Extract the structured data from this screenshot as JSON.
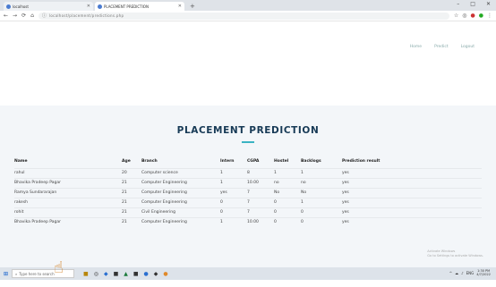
{
  "browser": {
    "tabs": [
      {
        "label": "localhost",
        "active": false
      },
      {
        "label": "PLACEMENT PREDICTION",
        "active": true
      }
    ],
    "new_tab": "+",
    "window_controls": [
      "–",
      "□",
      "✕"
    ],
    "url": "localhost/placement/predictions.php",
    "nav_buttons": [
      "←",
      "→",
      "⟳",
      "⌂"
    ],
    "extension_icons": [
      "☆",
      "◎",
      "●",
      "●",
      "⋮"
    ]
  },
  "site": {
    "nav": [
      "Home",
      "Predict",
      "Logout"
    ]
  },
  "page": {
    "title": "PLACEMENT PREDICTION",
    "accent_color": "#3bb3c3",
    "title_color": "#173a56"
  },
  "table": {
    "columns": [
      "Name",
      "Age",
      "Branch",
      "Intern",
      "CGPA",
      "Hostel",
      "Backlogs",
      "Prediction result"
    ],
    "rows": [
      [
        "rahul",
        "20",
        "Computer science",
        "1",
        "8",
        "1",
        "1",
        "yes"
      ],
      [
        "Bhavika Pradeep Pagar",
        "21",
        "Computer Engineering",
        "1",
        "10.00",
        "no",
        "no",
        "yes"
      ],
      [
        "Ramya Sundararajan",
        "21",
        "Computer Engineering",
        "yes",
        "7",
        "No",
        "No",
        "yes"
      ],
      [
        "rakesh",
        "21",
        "Computer Engineering",
        "0",
        "7",
        "0",
        "1",
        "yes"
      ],
      [
        "rohit",
        "21",
        "Civil Engineering",
        "0",
        "7",
        "0",
        "0",
        "yes"
      ],
      [
        "Bhavika Pradeep Pagar",
        "21",
        "Computer Engineering",
        "1",
        "10.00",
        "0",
        "0",
        "yes"
      ]
    ]
  },
  "watermark": {
    "line1": "Activate Windows",
    "line2": "Go to Settings to activate Windows."
  },
  "taskbar": {
    "start_icon": "⊞",
    "search_placeholder": "Type here to search",
    "app_icons": [
      "■",
      "◎",
      "◆",
      "■",
      "▲",
      "■",
      "●",
      "◆",
      "●"
    ],
    "tray": [
      "^",
      "☁",
      "♪",
      "ENG"
    ],
    "time": "1:30 PM",
    "date": "4/7/2022"
  }
}
